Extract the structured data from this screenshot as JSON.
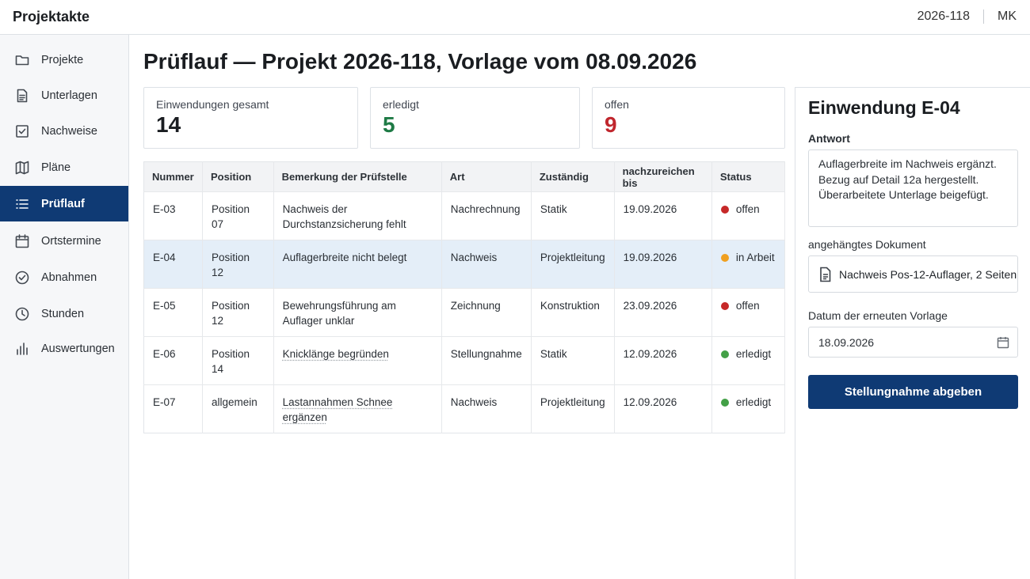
{
  "app": {
    "title": "Projektakte",
    "project_id": "2026-118",
    "user_initials": "MK"
  },
  "sidebar": {
    "items": [
      {
        "label": "Projekte",
        "icon": "folder-icon"
      },
      {
        "label": "Unterlagen",
        "icon": "document-icon"
      },
      {
        "label": "Nachweise",
        "icon": "checkbox-icon"
      },
      {
        "label": "Pläne",
        "icon": "map-icon"
      },
      {
        "label": "Prüflauf",
        "icon": "list-icon",
        "active": true
      },
      {
        "label": "Ortstermine",
        "icon": "calendar-icon"
      },
      {
        "label": "Abnahmen",
        "icon": "check-circle-icon"
      },
      {
        "label": "Stunden",
        "icon": "clock-icon"
      },
      {
        "label": "Auswertungen",
        "icon": "bar-chart-icon"
      }
    ]
  },
  "page": {
    "title": "Prüflauf — Projekt 2026-118, Vorlage vom 08.09.2026"
  },
  "stats": {
    "total": {
      "label": "Einwendungen gesamt",
      "value": "14",
      "color": "#1a1d21"
    },
    "done": {
      "label": "erledigt",
      "value": "5",
      "color": "#1e7a45"
    },
    "open": {
      "label": "offen",
      "value": "9",
      "color": "#c0262d"
    }
  },
  "table": {
    "headers": [
      "Nummer",
      "Position",
      "Bemerkung der Prüfstelle",
      "Art",
      "Zuständig",
      "nachzureichen bis",
      "Status"
    ],
    "rows": [
      {
        "nummer": "E-03",
        "position": "Position 07",
        "bemerkung": "Nachweis der Durchstanzsicherung fehlt",
        "art": "Nachrechnung",
        "zustaendig": "Statik",
        "bis": "19.09.2026",
        "status": "offen",
        "status_color": "#c62828"
      },
      {
        "nummer": "E-04",
        "position": "Position 12",
        "bemerkung": "Auflagerbreite nicht belegt",
        "art": "Nachweis",
        "zustaendig": "Projektleitung",
        "bis": "19.09.2026",
        "status": "in Arbeit",
        "status_color": "#f0a020"
      },
      {
        "nummer": "E-05",
        "position": "Position 12",
        "bemerkung": "Bewehrungsführung am Auflager unklar",
        "art": "Zeichnung",
        "zustaendig": "Konstruktion",
        "bis": "23.09.2026",
        "status": "offen",
        "status_color": "#c62828"
      },
      {
        "nummer": "E-06",
        "position": "Position 14",
        "bemerkung": "Knicklänge begründen",
        "art": "Stellungnahme",
        "zustaendig": "Statik",
        "bis": "12.09.2026",
        "status": "erledigt",
        "status_color": "#43a047"
      },
      {
        "nummer": "E-07",
        "position": "allgemein",
        "bemerkung": "Lastannahmen Schnee ergänzen",
        "art": "Nachweis",
        "zustaendig": "Projektleitung",
        "bis": "12.09.2026",
        "status": "erledigt",
        "status_color": "#43a047"
      }
    ]
  },
  "detail": {
    "title": "Einwendung E-04",
    "answer_label": "Antwort",
    "answer_text": "Auflagerbreite im Nachweis ergänzt. Bezug auf Detail 12a hergestellt. Überarbeitete Unterlage beigefügt.",
    "attachment_label": "angehängtes Dokument",
    "attachment_name": "Nachweis Pos-12-Auflager, 2 Seiten",
    "date_label": "Datum der erneuten Vorlage",
    "date_value": "18.09.2026",
    "submit_label": "Stellungnahme abgeben"
  }
}
